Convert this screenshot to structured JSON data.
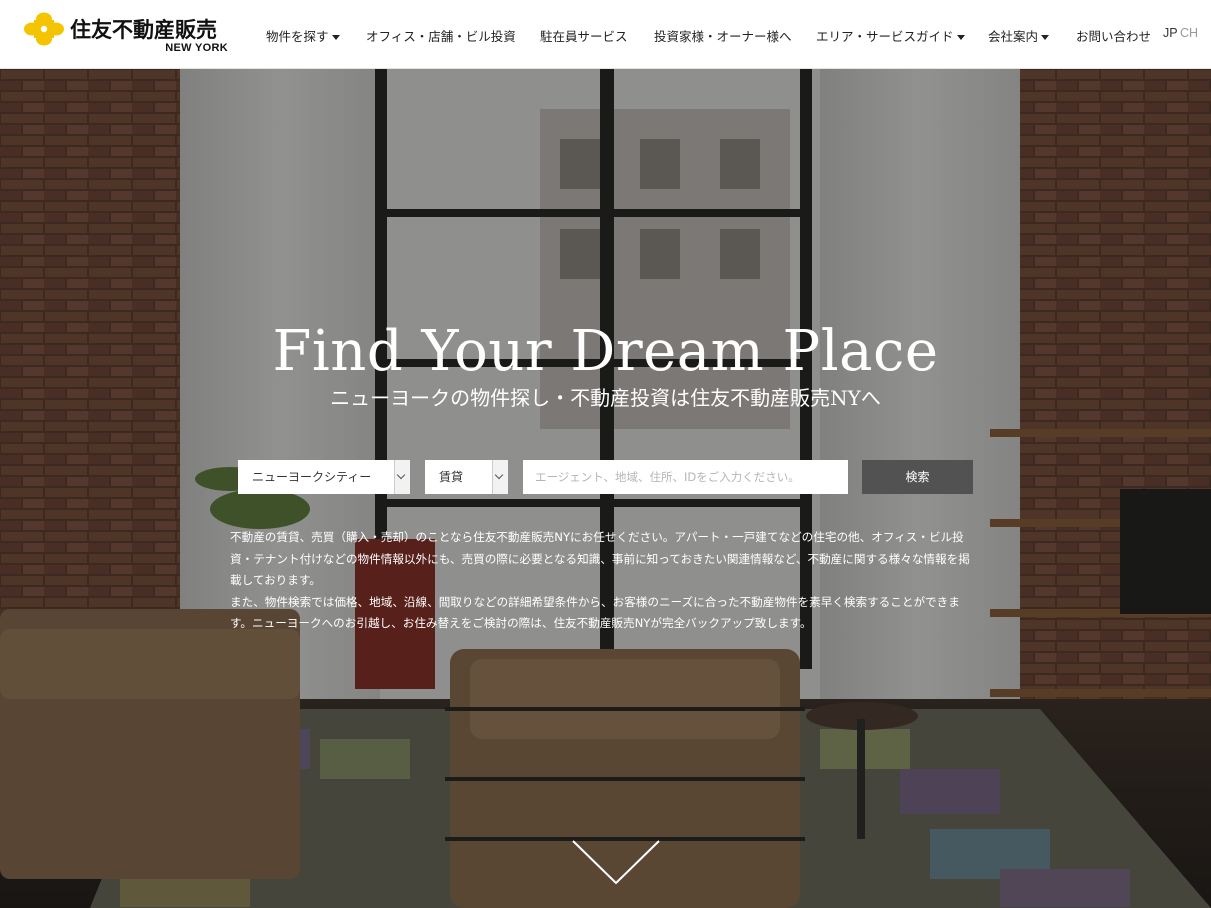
{
  "brand": {
    "name": "住友不動産販売",
    "sub": "NEW YORK",
    "mark_color": "#f5c400"
  },
  "nav": {
    "items": [
      {
        "label": "物件を探す",
        "dropdown": true
      },
      {
        "label": "オフィス・店舗・ビル投資",
        "dropdown": false
      },
      {
        "label": "駐在員サービス",
        "dropdown": false
      },
      {
        "label": "投資家様・オーナー様へ",
        "dropdown": false
      },
      {
        "label": "エリア・サービスガイド",
        "dropdown": true
      },
      {
        "label": "会社案内",
        "dropdown": true
      },
      {
        "label": "お問い合わせ",
        "dropdown": false
      }
    ],
    "lang": {
      "jp": "JP",
      "ch": "CH"
    }
  },
  "hero": {
    "title": "Find Your Dream Place",
    "subtitle": "ニューヨークの物件探し・不動産投資は住友不動産販売NYへ",
    "search": {
      "area_selected": "ニューヨークシティー",
      "type_selected": "賃貸",
      "placeholder": "エージェント、地域、住所、IDをご入力ください。",
      "button": "検索"
    },
    "description": [
      "不動産の賃貸、売買（購入・売却）のことなら住友不動産販売NYにお任せください。アパート・一戸建てなどの住宅の他、オフィス・ビル投資・テナント付けなどの物件情報以外にも、売買の際に必要となる知識、事前に知っておきたい関連情報など、不動産に関する様々な情報を掲載しております。",
      "また、物件検索では価格、地域、沿線、間取りなどの詳細希望条件から、お客様のニーズに合った不動産物件を素早く検索することができます。ニューヨークへのお引越し、お住み替えをご検討の際は、住友不動産販売NYが完全バックアップ致します。"
    ]
  },
  "colors": {
    "header_bg": "#ffffff",
    "search_button": "#525252",
    "text_on_hero": "#ffffff"
  }
}
